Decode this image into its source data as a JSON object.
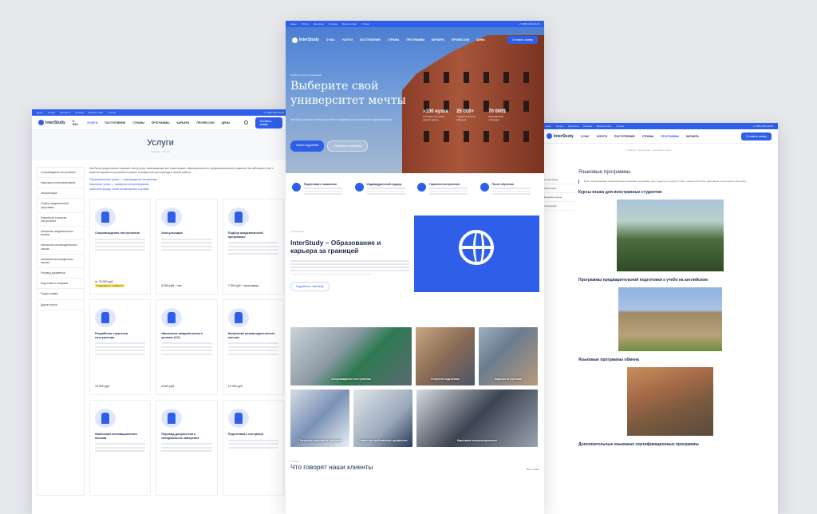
{
  "brand": {
    "name": "InterStudy",
    "accent": "#2f5fe8"
  },
  "topbar": {
    "links": [
      "Цены",
      "Услуги",
      "Контакты",
      "Отзывы",
      "Вопрос-ответ",
      "Статьи"
    ],
    "phone": "+7 (985) 000-00-00"
  },
  "nav": {
    "items": [
      "О НАС",
      "УСЛУГИ",
      "ПОСТУПЛЕНИЕ",
      "СТРАНЫ",
      "ПРОГРАММЫ",
      "КАРЬЕРА",
      "ПРОФЕССИИ",
      "ЦЕНЫ"
    ],
    "cta": "Оставить заявку"
  },
  "left_page": {
    "title": "Услуги",
    "crumb": "Главная · Услуги",
    "side_menu": [
      "Сопровождение поступления",
      "Карьерное консультирование",
      "Консультация",
      "Подбор академической программы",
      "Разработка стратегии поступления",
      "Написание академического резюме",
      "Написание рекомендательного письма",
      "Написание мотивационного письма",
      "Перевод документов",
      "Подготовка к интервью",
      "Подача заявки",
      "Другие услуги"
    ],
    "intro": "InterStudy предоставляет широкий спектр услуг, охватывающих все этапы вашего образовательного и профессионального развития. Мы заботимся о вас с момента первичного решения поступить в университет до переезда и начала работы.",
    "links": [
      "Образовательные услуги — сопровождение поступления",
      "Карьерные услуги — карьерное консультирование",
      "Заполните форму, чтобы познакомиться с ценами"
    ],
    "cards": [
      {
        "title": "Сопровождение поступления",
        "price": "от 70 000 руб.",
        "note": "Подробнее о стоимости"
      },
      {
        "title": "Консультация",
        "price": "8 000 руб. / час"
      },
      {
        "title": "Подбор академической программы",
        "price": "7 000 руб. / программа"
      },
      {
        "title": "Разработка стратегии поступления",
        "price": "15 000 руб."
      },
      {
        "title": "Написание академического резюме (CV)",
        "price": "8 000 руб."
      },
      {
        "title": "Написание рекомендательного письма",
        "price": "12 000 руб."
      },
      {
        "title": "Написание мотивационного письма"
      },
      {
        "title": "Перевод документов и нотариальное заверение"
      },
      {
        "title": "Подготовка к интервью"
      }
    ]
  },
  "center_page": {
    "hero": {
      "eyebrow": "Подбор учебного заведения",
      "title": "Выберите свой университет мечты",
      "desc": "InterStudy поможет с выбором учебного заведения и поступлением в зарубежный вуз",
      "btn_primary": "Узнать подробнее",
      "btn_secondary": "Подобрать программу",
      "stats": [
        {
          "value": ">100 вузов",
          "label": "в которые поступили наши студенты"
        },
        {
          "value": "25 000+",
          "label": "студентов прошли обучение"
        },
        {
          "value": "70 000$",
          "label": "максимальная стипендия"
        }
      ]
    },
    "features": [
      {
        "title": "Подготовка к экзаменам"
      },
      {
        "title": "Индивидуальный подход"
      },
      {
        "title": "Гарантия поступления"
      },
      {
        "title": "После обучения"
      }
    ],
    "about": {
      "label": "О компании",
      "title": "InterStudy – Образование и карьера за границей",
      "link": "Подробнее о InterStudy"
    },
    "tiles": [
      "Сопровождение поступления",
      "Услуги по подготовке",
      "Карьера за рубежом",
      "Построить карьеру за границей",
      "Самые востребованные профессии",
      "Карьерное консультирование"
    ],
    "reviews": {
      "label": "Отзывы",
      "title": "Что говорят наши клиенты",
      "all": "Все отзывы"
    }
  },
  "right_page": {
    "crumb": "Главная · Программы · Языковые курсы",
    "side_menu": [
      "Поступление",
      "Подготовка",
      "Языковые курсы",
      "Стажировки"
    ],
    "title": "Языковые программы",
    "quote": "Вузы подразумевают разнообразные языковые программы для студентов из других стран с целью облегчить адаптацию и культурного обучения.",
    "sections": [
      {
        "title": "Курсы языка для иностранных студентов"
      },
      {
        "title": "Программы предварительной подготовки к учебе на английском"
      },
      {
        "title": "Языковые программы обмена"
      },
      {
        "title": "Дополнительные языковые сертификационные программы"
      }
    ]
  }
}
